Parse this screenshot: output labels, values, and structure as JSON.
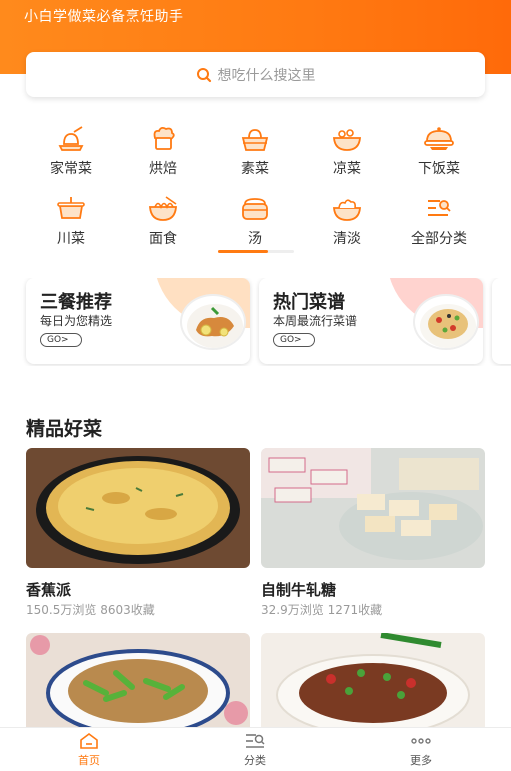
{
  "header": {
    "tagline": "小白学做菜必备烹饪助手"
  },
  "search": {
    "placeholder": "想吃什么搜这里"
  },
  "categories": [
    {
      "label": "家常菜",
      "icon": "chef-hat-cutting-board-icon"
    },
    {
      "label": "烘焙",
      "icon": "baking-hat-icon"
    },
    {
      "label": "素菜",
      "icon": "vegetable-basket-icon"
    },
    {
      "label": "凉菜",
      "icon": "cold-dish-bowl-icon"
    },
    {
      "label": "下饭菜",
      "icon": "covered-dish-icon"
    },
    {
      "label": "川菜",
      "icon": "pot-icon"
    },
    {
      "label": "面食",
      "icon": "noodle-bowl-icon"
    },
    {
      "label": "汤",
      "icon": "soup-pot-icon"
    },
    {
      "label": "清淡",
      "icon": "salad-bowl-icon"
    },
    {
      "label": "全部分类",
      "icon": "category-list-icon"
    }
  ],
  "recommend": [
    {
      "title": "三餐推荐",
      "subtitle": "每日为您精选",
      "go": "GO>"
    },
    {
      "title": "热门菜谱",
      "subtitle": "本周最流行菜谱",
      "go": "GO>"
    }
  ],
  "section": {
    "title": "精品好菜"
  },
  "foods": [
    {
      "name": "香蕉派",
      "views": "150.5万浏览",
      "favs": "8603收藏"
    },
    {
      "name": "自制牛轧糖",
      "views": "32.9万浏览",
      "favs": "1271收藏"
    }
  ],
  "tabs": [
    {
      "label": "首页",
      "active": true
    },
    {
      "label": "分类",
      "active": false
    },
    {
      "label": "更多",
      "active": false
    }
  ],
  "colors": {
    "accent": "#ff7a12",
    "blob1": "#ffe0c2",
    "blob2": "#ffd3cf"
  }
}
